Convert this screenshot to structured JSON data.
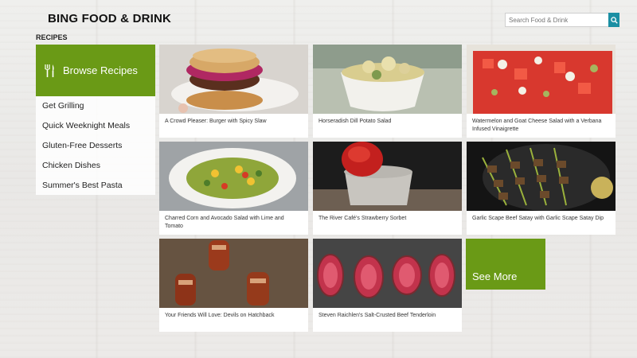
{
  "header": {
    "app_title": "BING FOOD & DRINK",
    "search_placeholder": "Search Food & Drink"
  },
  "section_label": "RECIPES",
  "browse_tile": {
    "label": "Browse Recipes",
    "icon": "fork-knife-icon"
  },
  "categories": [
    {
      "label": "Get Grilling"
    },
    {
      "label": "Quick Weeknight Meals"
    },
    {
      "label": "Gluten-Free Desserts"
    },
    {
      "label": "Chicken Dishes"
    },
    {
      "label": "Summer's Best Pasta"
    }
  ],
  "recipes": [
    {
      "title": "A Crowd Pleaser: Burger with Spicy Slaw"
    },
    {
      "title": "Horseradish Dill Potato Salad"
    },
    {
      "title": "Watermelon and Goat Cheese Salad with a Verbana Infused Vinaigrette"
    },
    {
      "title": "Charred Corn and Avocado Salad with Lime and Tomato"
    },
    {
      "title": "The River Café's Strawberry Sorbet"
    },
    {
      "title": "Garlic Scape Beef Satay with Garlic Scape Satay Dip"
    },
    {
      "title": "Your Friends Will Love: Devils on Hatchback"
    },
    {
      "title": "Steven Raichlen's Salt-Crusted Beef Tenderloin"
    }
  ],
  "see_more": {
    "label": "See More"
  },
  "colors": {
    "accent_green": "#6a9a16",
    "search_button": "#1b8fa3"
  }
}
